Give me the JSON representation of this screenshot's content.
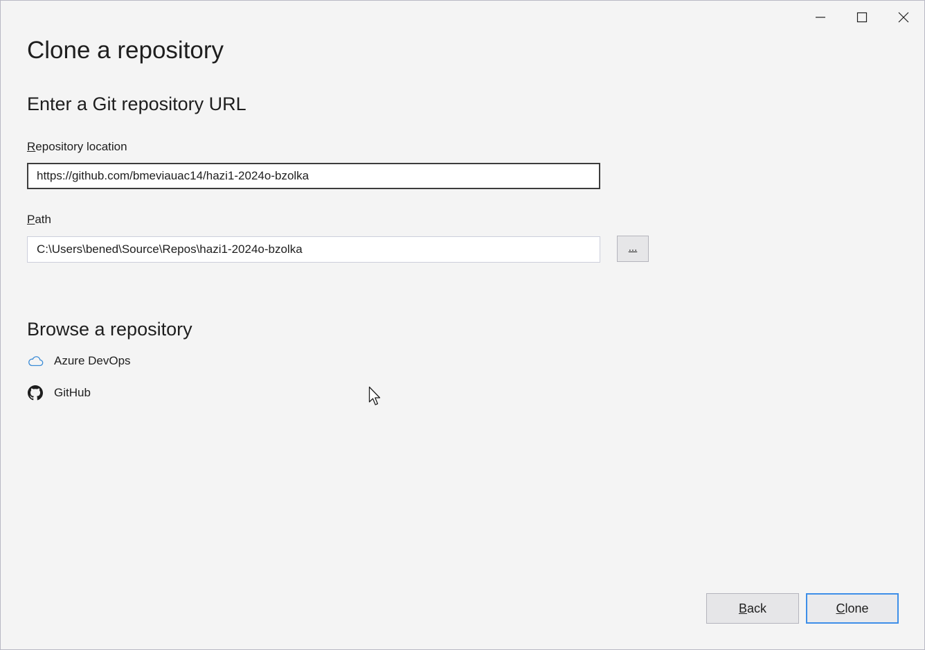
{
  "window": {
    "title": "Clone a repository",
    "controls": [
      "minimize-icon",
      "maximize-icon",
      "close-icon"
    ]
  },
  "clone_section": {
    "heading": "Enter a Git repository URL",
    "repo_location": {
      "label_access_key": "R",
      "label_rest": "epository location",
      "value": "https://github.com/bmeviauac14/hazi1-2024o-bzolka"
    },
    "path": {
      "label_access_key": "P",
      "label_rest": "ath",
      "value": "C:\\Users\\bened\\Source\\Repos\\hazi1-2024o-bzolka",
      "browse_label": "..."
    }
  },
  "browse_section": {
    "heading": "Browse a repository",
    "items": [
      {
        "label": "Azure DevOps",
        "icon": "cloud-icon",
        "color": "#3a8bd6"
      },
      {
        "label": "GitHub",
        "icon": "github-icon",
        "color": "#1e1e1e"
      }
    ]
  },
  "footer": {
    "back": {
      "access_key": "B",
      "rest": "ack"
    },
    "clone": {
      "access_key": "C",
      "rest": "lone"
    }
  },
  "colors": {
    "background": "#f4f4f4",
    "accent": "#3d8ee8",
    "border": "#cccedb"
  }
}
